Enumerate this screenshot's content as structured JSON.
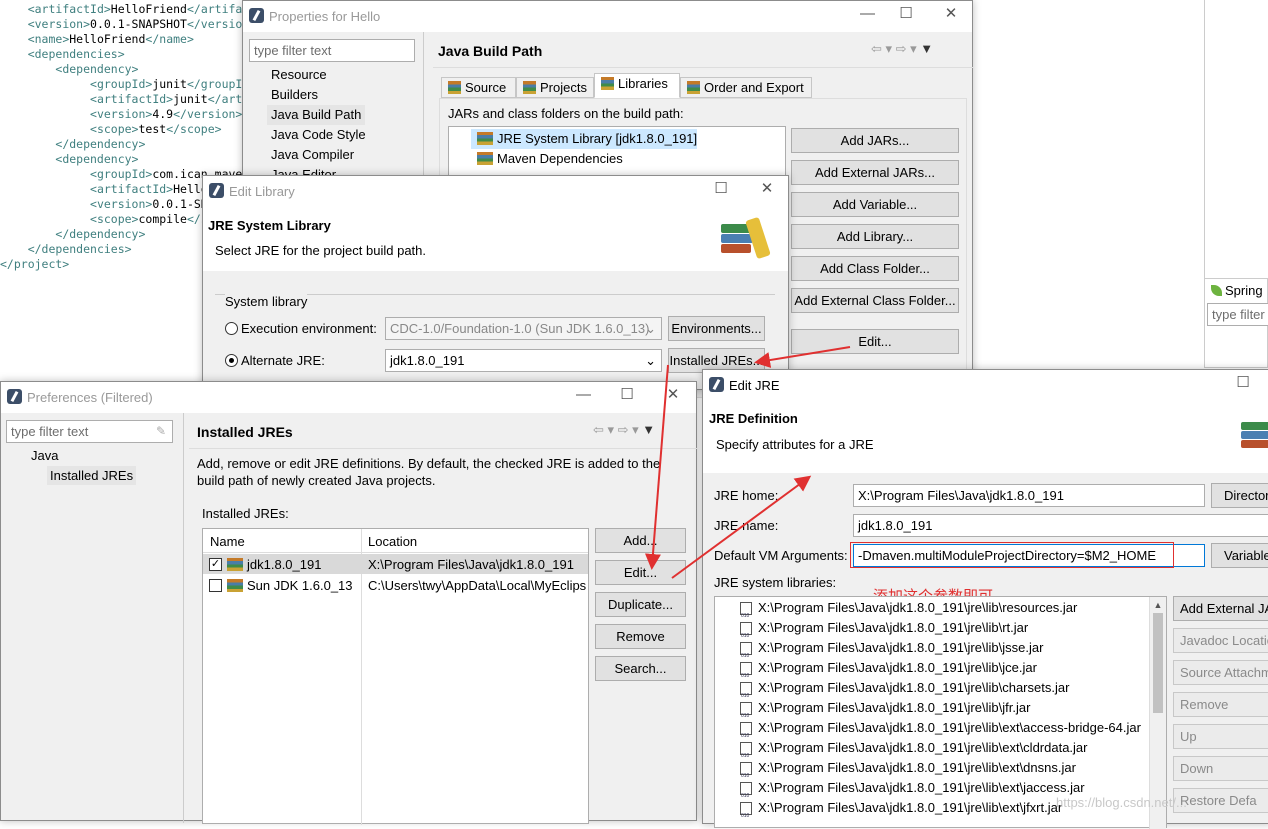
{
  "xml": {
    "lines": [
      {
        "indent": "    ",
        "open": "<artifactId>",
        "text": "HelloFriend",
        "close": "</artifa"
      },
      {
        "indent": "    ",
        "open": "<version>",
        "text": "0.0.1-SNAPSHOT",
        "close": "</versio"
      },
      {
        "indent": "    ",
        "open": "<name>",
        "text": "HelloFriend",
        "close": "</name>"
      },
      {
        "indent": "    ",
        "open": "<dependencies>",
        "text": "",
        "close": ""
      },
      {
        "indent": "        ",
        "open": "<dependency>",
        "text": "",
        "close": ""
      },
      {
        "indent": "             ",
        "open": "<groupId>",
        "text": "junit",
        "close": "</groupId"
      },
      {
        "indent": "             ",
        "open": "<artifactId>",
        "text": "junit",
        "close": "</arti"
      },
      {
        "indent": "             ",
        "open": "<version>",
        "text": "4.9",
        "close": "</version>"
      },
      {
        "indent": "             ",
        "open": "<scope>",
        "text": "test",
        "close": "</scope>"
      },
      {
        "indent": "        ",
        "open": "</dependency>",
        "text": "",
        "close": ""
      },
      {
        "indent": "        ",
        "open": "<dependency>",
        "text": "",
        "close": ""
      },
      {
        "indent": "             ",
        "open": "<groupId>",
        "text": "com.ican.maven",
        "close": ""
      },
      {
        "indent": "             ",
        "open": "<artifactId>",
        "text": "Hello",
        "close": ""
      },
      {
        "indent": "             ",
        "open": "<version>",
        "text": "0.0.1-SNA",
        "close": ""
      },
      {
        "indent": "             ",
        "open": "<scope>",
        "text": "compile",
        "close": "</s"
      },
      {
        "indent": "        ",
        "open": "</dependency>",
        "text": "",
        "close": ""
      },
      {
        "indent": "    ",
        "open": "</dependencies>",
        "text": "",
        "close": ""
      },
      {
        "indent": "",
        "open": "</project>",
        "text": "",
        "close": ""
      }
    ]
  },
  "spring": {
    "title": "Spring",
    "filter_placeholder": "type filter"
  },
  "properties": {
    "title": "Properties for Hello",
    "filter_placeholder": "type filter text",
    "tree": [
      "Resource",
      "Builders",
      "Java Build Path",
      "Java Code Style",
      "Java Compiler",
      "Java Editor"
    ],
    "heading": "Java Build Path",
    "tabs": [
      "Source",
      "Projects",
      "Libraries",
      "Order and Export"
    ],
    "jars_label": "JARs and class folders on the build path:",
    "libs": [
      "JRE System Library [jdk1.8.0_191]",
      "Maven Dependencies"
    ],
    "buttons": [
      "Add JARs...",
      "Add External JARs...",
      "Add Variable...",
      "Add Library...",
      "Add Class Folder...",
      "Add External Class Folder...",
      "Edit..."
    ]
  },
  "edit_library": {
    "title": "Edit Library",
    "heading": "JRE System Library",
    "subtitle": "Select JRE for the project build path.",
    "group": "System library",
    "exec_env_label": "Execution environment:",
    "exec_env_value": "CDC-1.0/Foundation-1.0 (Sun JDK 1.6.0_13)",
    "env_button": "Environments...",
    "alt_jre_label": "Alternate JRE:",
    "alt_jre_value": "jdk1.8.0_191",
    "installed_button": "Installed JREs..."
  },
  "preferences": {
    "title": "Preferences (Filtered)",
    "filter_placeholder": "type filter text",
    "tree_java": "Java",
    "tree_installed": "Installed JREs",
    "heading": "Installed JREs",
    "desc": "Add, remove or edit JRE definitions. By default, the checked JRE is added to the build path of newly created Java projects.",
    "list_label": "Installed JREs:",
    "col_name": "Name",
    "col_location": "Location",
    "rows": [
      {
        "name": "jdk1.8.0_191",
        "location": "X:\\Program Files\\Java\\jdk1.8.0_191"
      },
      {
        "name": "Sun JDK 1.6.0_13",
        "location": "C:\\Users\\twy\\AppData\\Local\\MyEclips"
      }
    ],
    "buttons": [
      "Add...",
      "Edit...",
      "Duplicate...",
      "Remove",
      "Search..."
    ]
  },
  "edit_jre": {
    "title": "Edit JRE",
    "heading": "JRE Definition",
    "subtitle": "Specify attributes for a JRE",
    "home_label": "JRE home:",
    "home_value": "X:\\Program Files\\Java\\jdk1.8.0_191",
    "dir_button": "Director",
    "name_label": "JRE name:",
    "name_value": "jdk1.8.0_191",
    "vm_label": "Default VM Arguments:",
    "vm_value": "-Dmaven.multiModuleProjectDirectory=$M2_HOME",
    "var_button": "Variable",
    "annotation": "添加这个参数即可",
    "libs_label": "JRE system libraries:",
    "libs": [
      "X:\\Program Files\\Java\\jdk1.8.0_191\\jre\\lib\\resources.jar",
      "X:\\Program Files\\Java\\jdk1.8.0_191\\jre\\lib\\rt.jar",
      "X:\\Program Files\\Java\\jdk1.8.0_191\\jre\\lib\\jsse.jar",
      "X:\\Program Files\\Java\\jdk1.8.0_191\\jre\\lib\\jce.jar",
      "X:\\Program Files\\Java\\jdk1.8.0_191\\jre\\lib\\charsets.jar",
      "X:\\Program Files\\Java\\jdk1.8.0_191\\jre\\lib\\jfr.jar",
      "X:\\Program Files\\Java\\jdk1.8.0_191\\jre\\lib\\ext\\access-bridge-64.jar",
      "X:\\Program Files\\Java\\jdk1.8.0_191\\jre\\lib\\ext\\cldrdata.jar",
      "X:\\Program Files\\Java\\jdk1.8.0_191\\jre\\lib\\ext\\dnsns.jar",
      "X:\\Program Files\\Java\\jdk1.8.0_191\\jre\\lib\\ext\\jaccess.jar",
      "X:\\Program Files\\Java\\jdk1.8.0_191\\jre\\lib\\ext\\jfxrt.jar"
    ],
    "side_buttons": [
      "Add External JA",
      "Javadoc Locatio",
      "Source Attachm",
      "Remove",
      "Up",
      "Down",
      "Restore Defa"
    ]
  },
  "watermark": "https://blog.csdn.net/...",
  "colors": {
    "arrow": "#e03030",
    "annotation": "#e03030",
    "selection": "#cce8ff"
  }
}
